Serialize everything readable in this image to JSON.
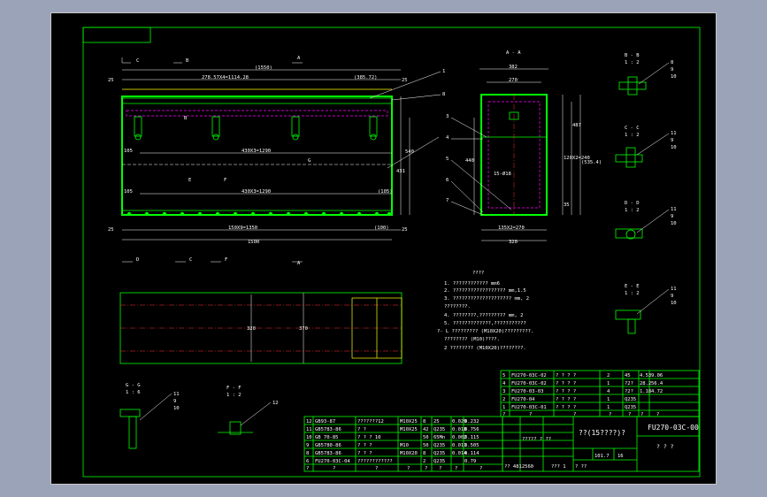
{
  "drawing": {
    "top_section_markers": [
      "C",
      "B",
      "A"
    ],
    "bottom_section_markers": [
      "D",
      "C",
      "F",
      "A"
    ],
    "dims_top": {
      "overall": "(1550)",
      "pitch": "278.57X4=1114.28",
      "right": "(385.72)",
      "left_end": "25",
      "right_end": "25"
    },
    "dims_mid": {
      "pitch_a": "430X3=1290",
      "pitch_b": "430X3=1290",
      "left_105": "105",
      "left_105b": "105",
      "right_105": "(105)",
      "height_right": "540",
      "height_inner": "431"
    },
    "dims_bottom": {
      "pitch": "150X9=1350",
      "right": "(100)",
      "overall": "1500",
      "left_end": "25",
      "right_end": "25"
    },
    "labels_inner": [
      "B",
      "E",
      "F",
      "G"
    ],
    "section_aa": {
      "title": "A - A",
      "w_outer": "382",
      "w_inner": "270",
      "bottom_dim": "135X2=270",
      "bottom_total": "320",
      "h1": "120X2=240",
      "h2": "487",
      "h3": "(535.4)",
      "h_left": "440",
      "note": "15-Ø18",
      "small": "35"
    },
    "callouts": [
      "1",
      "8",
      "3",
      "4",
      "5",
      "6",
      "7"
    ],
    "section_views": [
      {
        "title": "B - B",
        "scale": "1 : 2",
        "nums": [
          "8",
          "9",
          "10"
        ]
      },
      {
        "title": "C - C",
        "scale": "1 : 2",
        "nums": [
          "11",
          "9",
          "10"
        ]
      },
      {
        "title": "D - D",
        "scale": "1 : 2",
        "nums": [
          "11",
          "9",
          "10"
        ]
      },
      {
        "title": "E - E",
        "scale": "1 : 2",
        "nums": [
          "11",
          "9",
          "10"
        ]
      },
      {
        "title": "G - G",
        "scale": "1 : 6",
        "nums": [
          "11",
          "9",
          "10"
        ]
      },
      {
        "title": "F - F",
        "scale": "1 : 2",
        "nums": [
          "12"
        ]
      }
    ],
    "plan_dims": {
      "w": "320",
      "w2": "370"
    }
  },
  "notes": {
    "title": "????",
    "lines": [
      "1. ????????????  mm6",
      "2. ??????????????????  mm,1.5",
      "3. ????????????????????  mm, 2",
      "   ????????.",
      "4. ????????,?????????  mm, 2",
      "5. ?????????????,???????????",
      "?- L ?????????     (M10X20)?????????.",
      "   ????????    (M10)????.",
      "   2 ????????   (M10X20)????????."
    ]
  },
  "parts_upper": [
    [
      "5",
      "FU270-03C-02",
      "?  ?  ?  ?",
      "2",
      "45",
      "4.53",
      "9.06"
    ],
    [
      "4",
      "FU270-03C-02",
      "?  ?  ?  ?",
      "1",
      "?2?",
      "28.2",
      "56.4"
    ],
    [
      "3",
      "FU270-03-03",
      "?  ?  ?  ?",
      "4",
      "?2?",
      "1.18",
      "4.72"
    ],
    [
      "2",
      "FU270-04",
      "?  ?  ?  ?",
      "1",
      "Q235",
      "",
      ""
    ],
    [
      "1",
      "FU270-03C-01",
      "?  ?  ?  ?",
      "1",
      "Q235",
      "",
      ""
    ],
    [
      "?",
      "?",
      "?",
      "?",
      "?",
      "?",
      "?"
    ]
  ],
  "parts_lower": [
    [
      "12",
      "GB93-87",
      "???????12",
      "M10X25",
      "8",
      "25",
      "0.029",
      "0.232"
    ],
    [
      "11",
      "GB5783-86",
      "?  ?",
      "M10X25",
      "42",
      "Q235",
      "0.018",
      "0.756"
    ],
    [
      "10",
      "GB 70-85",
      "?  ?  ?  10",
      "",
      "50",
      "65Mn",
      "0.002",
      "0.115"
    ],
    [
      "9",
      "GB5780-86",
      "?  ?  ?",
      "M10",
      "50",
      "Q235",
      "0.011",
      "0.505"
    ],
    [
      "8",
      "GB5783-86",
      "?  ?  ?",
      "M10X20",
      "8",
      "Q235",
      "0.014",
      "0.114"
    ],
    [
      "6",
      "FU270-03C-04",
      "????????????",
      "",
      "2",
      "Q235",
      "",
      "0.79"
    ],
    [
      "?",
      "?",
      "?",
      "?",
      "?",
      "?",
      "?",
      "?"
    ]
  ],
  "title_block": {
    "name": "??(15????)?",
    "code": "FU270-03C-00",
    "sub": "?  ?  ?",
    "cells": [
      "101.7",
      "16",
      "?????"
    ],
    "scale_row": "?????   ?  ??",
    "misc": "?  ??",
    "date": "?? 4812560",
    "page": "??? 1"
  }
}
